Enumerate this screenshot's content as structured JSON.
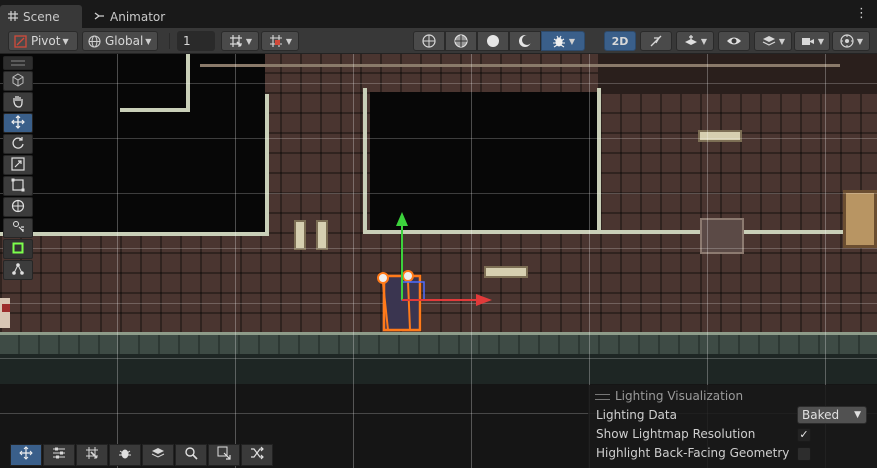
{
  "tabs": {
    "scene": {
      "label": "Scene",
      "icon": "grid-icon"
    },
    "animator": {
      "label": "Animator",
      "icon": "animator-icon"
    }
  },
  "toolbar": {
    "pivot_label": "Pivot",
    "global_label": "Global",
    "grid_snap_value": "1",
    "mode_2d_label": "2D"
  },
  "lighting": {
    "title": "Lighting Visualization",
    "rows": [
      {
        "label": "Lighting Data",
        "value": "Baked"
      },
      {
        "label": "Show Lightmap Resolution",
        "checked": true
      },
      {
        "label": "Highlight Back-Facing Geometry",
        "checked": false
      }
    ]
  },
  "colors": {
    "accent_blue": "#3a5f8a",
    "gizmo_x": "#e23a3a",
    "gizmo_y": "#3cd23c",
    "selection_outline": "#ff7a1a"
  }
}
